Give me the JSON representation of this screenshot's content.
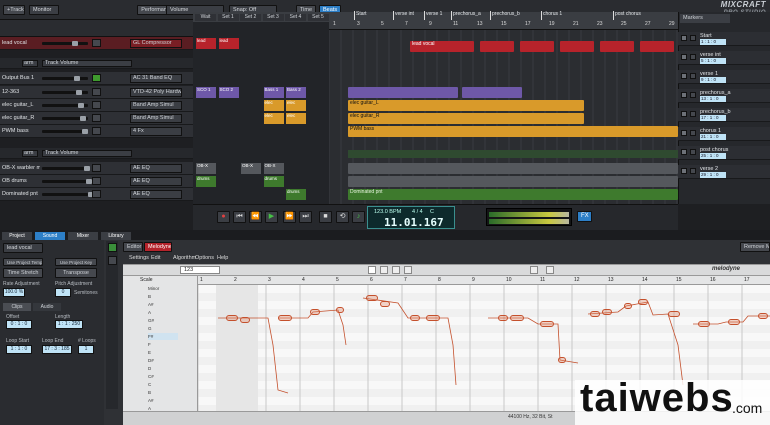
{
  "toolbar": {
    "track_label": "+Track",
    "monitor_label": "Monitor",
    "performance_label": "Performance",
    "volume_label": "Volume",
    "snap_label": "Snap: Off",
    "time_label": "Time",
    "beats_label": "Beats"
  },
  "logo": {
    "line1": "MIXCRAFT",
    "line2": "PRO STUDIO"
  },
  "tracks": [
    {
      "name": "lead vocal",
      "fx": "GL Compressor",
      "sel": true,
      "fx_red": true
    },
    {
      "name": "Output Bus 1",
      "fx": "AC 31 Band EQ",
      "sel": false,
      "green": true
    },
    {
      "name": "12-363",
      "fx": "VTD-42 Poly Hardw",
      "sel": false
    },
    {
      "name": "elec guitar_L",
      "fx": "Band Amp Simul",
      "sel": false
    },
    {
      "name": "elec guitar_R",
      "fx": "Band Amp Simul",
      "sel": false
    },
    {
      "name": "PWM bass",
      "fx": "4 Fx",
      "sel": false
    },
    {
      "name": "OB-X warbler m",
      "fx": "AE EQ",
      "sel": false
    },
    {
      "name": "OB drums",
      "fx": "AE EQ",
      "sel": false
    },
    {
      "name": "Dominated pnt",
      "fx": "AE EQ",
      "sel": false
    }
  ],
  "automation": [
    {
      "arm": "arm",
      "param": "Track Volume"
    },
    {
      "arm": "arm",
      "param": "Track Volume"
    }
  ],
  "performance_cols": [
    "Wait",
    "Set 1",
    "Set 2",
    "Set 3",
    "Set 4",
    "Set 5"
  ],
  "perf_clips": [
    "lead",
    "lead",
    "SCO 1",
    "SCO 2",
    "Bass 1",
    "Bass 2",
    "elec",
    "elec",
    "elec",
    "elec",
    "OB-X",
    "OB-X",
    "OB-X",
    "drums",
    "drums",
    "drums"
  ],
  "markers_top": [
    "Start",
    "verse int",
    "verse 1",
    "prechorus_a",
    "prechorus_b",
    "chorus 1",
    "post chorus"
  ],
  "ruler_numbers": [
    "1",
    "3",
    "5",
    "7",
    "9",
    "11",
    "13",
    "15",
    "17",
    "19",
    "21",
    "23",
    "25",
    "27",
    "29"
  ],
  "clips": {
    "vocal": "lead vocal",
    "guitar_l": "elec guitar_L",
    "guitar_r": "elec guitar_R",
    "bass": "PWM bass",
    "drums": "OB drums",
    "pad": "Dominated pnt"
  },
  "markers_panel": {
    "title": "Markers",
    "items": [
      {
        "name": "Start",
        "time": "1 : 1 : 0"
      },
      {
        "name": "verse int",
        "time": "5 : 1 : 0"
      },
      {
        "name": "verse 1",
        "time": "9 : 1 : 0"
      },
      {
        "name": "prechorus_a",
        "time": "13 : 1 : 0"
      },
      {
        "name": "prechorus_b",
        "time": "17 : 1 : 0"
      },
      {
        "name": "chorus 1",
        "time": "21 : 1 : 0"
      },
      {
        "name": "post chorus",
        "time": "25 : 1 : 0"
      },
      {
        "name": "verse 2",
        "time": "29 : 1 : 0"
      }
    ]
  },
  "transport": {
    "tempo": "123.0 BPM",
    "sig": "4 / 4",
    "key": "C",
    "position": "11.01.167",
    "fx": "FX"
  },
  "tabs": [
    "Project",
    "Sound",
    "Mixer",
    "Library"
  ],
  "left_panel": {
    "track": "lead vocal",
    "use_tempo": "Use Project Tempo",
    "use_key": "Use Project Key",
    "time_stretch": "Time Stretch",
    "transpose": "Transpose",
    "rate_label": "Rate Adjustment",
    "pitch_label": "Pitch Adjustment",
    "rate": "100.0 %",
    "pitch": "0",
    "semitones": "Semitones",
    "subtabs": [
      "Clips",
      "Audio"
    ],
    "offset_label": "Offset",
    "length_label": "Length",
    "offset": "0 : 1 : 0",
    "length": "1 : 1 : 250",
    "loop_start_label": "Loop Start",
    "loop_end_label": "Loop End",
    "loops_label": "# Loops",
    "loop_start": "1 : 1 : 0",
    "loop_end": "17 : 3 : 185",
    "loops": "1"
  },
  "editor": {
    "editor_tab": "Editor",
    "melodyne_tab": "Melodyne",
    "menus": [
      "Settings",
      "Edit",
      "Algorithm",
      "Options",
      "Help"
    ],
    "value": "123",
    "remove_label": "Remove Me",
    "brand": "melodyne",
    "scale_label": "Scale",
    "scale_items": [
      "Minor",
      "B",
      "A#",
      "A",
      "G#",
      "G",
      "F#",
      "F",
      "E",
      "D#",
      "D",
      "C#",
      "C",
      "B",
      "A#",
      "A"
    ],
    "ruler": [
      "1",
      "2",
      "3",
      "4",
      "5",
      "6",
      "7",
      "8",
      "9",
      "10",
      "11",
      "12",
      "13",
      "14",
      "15",
      "16",
      "17"
    ],
    "status": "44100 Hz, 32 Bit, St"
  },
  "watermark": "taiwebs",
  "watermark_suffix": ".com"
}
